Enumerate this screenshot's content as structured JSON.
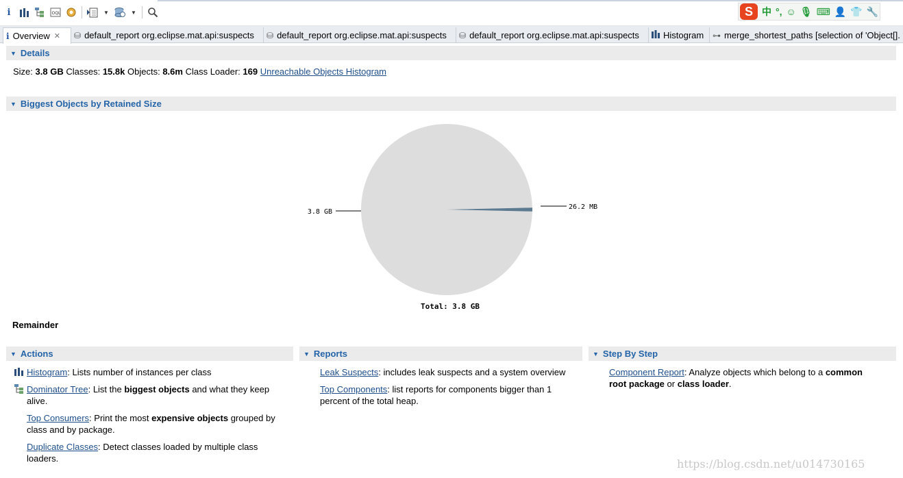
{
  "toolbar": {
    "icons": [
      "info-icon",
      "histogram-icon",
      "dominator-tree-icon",
      "oql-icon",
      "heap-dump-overview-icon",
      "run-report-icon",
      "dropdown-arrow",
      "query-browser-icon",
      "dropdown-arrow",
      "search-icon"
    ],
    "ime_logo": "S",
    "ime_items": [
      "中",
      "°,",
      "☺",
      "🎙",
      "⌨",
      "👤",
      "👕",
      "🔧"
    ]
  },
  "tabs": [
    {
      "label": "Overview",
      "icon": "i",
      "active": true
    },
    {
      "label": "default_report  org.eclipse.mat.api:suspects"
    },
    {
      "label": "default_report  org.eclipse.mat.api:suspects"
    },
    {
      "label": "default_report  org.eclipse.mat.api:suspects"
    },
    {
      "label": "Histogram"
    },
    {
      "label": "merge_shortest_paths [selection of 'Object[]."
    }
  ],
  "details": {
    "header": "Details",
    "size_label": "Size:",
    "size": "3.8 GB",
    "classes_label": "Classes:",
    "classes": "15.8k",
    "objects_label": "Objects:",
    "objects": "8.6m",
    "loader_label": "Class Loader:",
    "loader": "169",
    "link": "Unreachable Objects Histogram"
  },
  "biggest": {
    "header": "Biggest Objects by Retained Size",
    "remainder_label": "Remainder"
  },
  "chart_data": {
    "type": "pie",
    "values": [
      3.8,
      0.0262
    ],
    "labels": [
      "3.8 GB",
      "26.2 MB"
    ],
    "total_label": "Total: 3.8 GB",
    "colors": [
      "#dddddd",
      "#5c7a90"
    ]
  },
  "actions": {
    "header": "Actions",
    "items": [
      {
        "link": "Histogram",
        "text_a": ": Lists number of instances per class",
        "bold": "",
        "text_b": ""
      },
      {
        "link": "Dominator Tree",
        "text_a": ": List the ",
        "bold": "biggest objects",
        "text_b": " and what they keep alive."
      },
      {
        "link": "Top Consumers",
        "text_a": ": Print the most ",
        "bold": "expensive objects",
        "text_b": " grouped by class and by package."
      },
      {
        "link": "Duplicate Classes",
        "text_a": ": Detect classes loaded by multiple class loaders.",
        "bold": "",
        "text_b": ""
      }
    ]
  },
  "reports": {
    "header": "Reports",
    "items": [
      {
        "link": "Leak Suspects",
        "text": ": includes leak suspects and a system overview"
      },
      {
        "link": "Top Components",
        "text": ": list reports for components bigger than 1 percent of the total heap."
      }
    ]
  },
  "stepbystep": {
    "header": "Step By Step",
    "link": "Component Report",
    "text_a": ": Analyze objects which belong to a ",
    "bold_a": "common root package",
    "text_b": " or ",
    "bold_b": "class loader",
    "text_c": "."
  },
  "watermark": "https://blog.csdn.net/u014730165"
}
